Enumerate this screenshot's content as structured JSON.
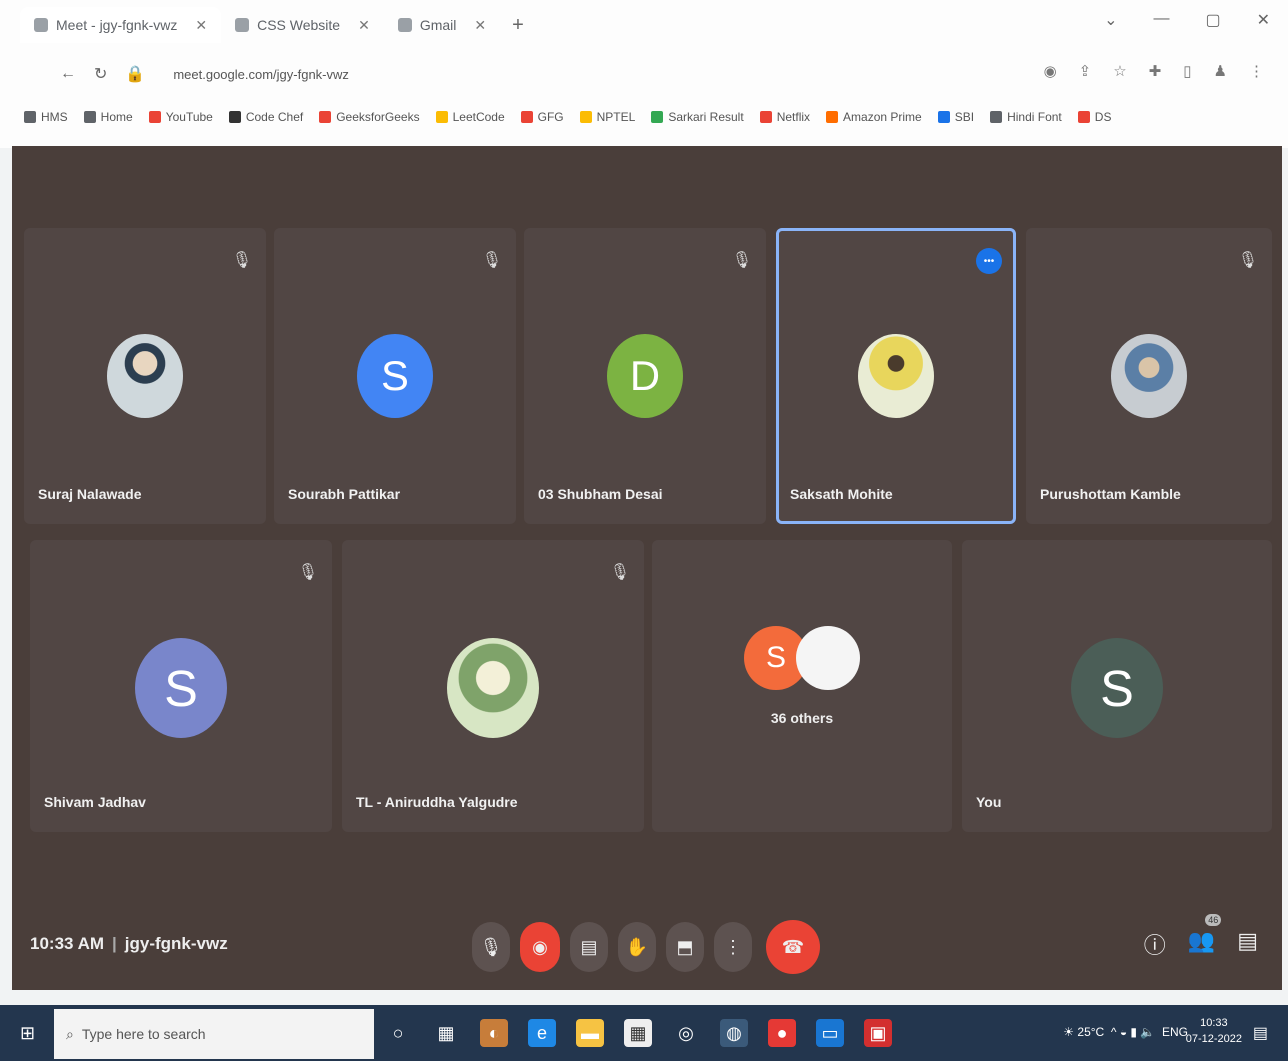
{
  "browser": {
    "tabs": [
      {
        "label": "Meet - jgy-fgnk-vwz",
        "active": true
      },
      {
        "label": "CSS Website",
        "active": false
      },
      {
        "label": "Gmail",
        "active": false
      }
    ],
    "new_tab_label": "+",
    "url": "meet.google.com/jgy-fgnk-vwz",
    "bookmarks": [
      {
        "label": "HMS",
        "color": "#5f6368"
      },
      {
        "label": "Home",
        "color": "#5f6368"
      },
      {
        "label": "YouTube",
        "color": "#ea4335"
      },
      {
        "label": "Code Chef",
        "color": "#333333"
      },
      {
        "label": "GeeksforGeeks",
        "color": "#ea4335"
      },
      {
        "label": "LeetCode",
        "color": "#fbbc04"
      },
      {
        "label": "GFG",
        "color": "#ea4335"
      },
      {
        "label": "NPTEL",
        "color": "#fbbc04"
      },
      {
        "label": "Sarkari Result",
        "color": "#34a853"
      },
      {
        "label": "Netflix",
        "color": "#ea4335"
      },
      {
        "label": "Amazon Prime",
        "color": "#ff6d00"
      },
      {
        "label": "SBI",
        "color": "#1a73e8"
      },
      {
        "label": "Hindi Font",
        "color": "#5f6368"
      },
      {
        "label": "DS",
        "color": "#ea4335"
      }
    ]
  },
  "meeting": {
    "background": "#4a3e3a",
    "participants": [
      {
        "name": "Suraj Nalawade",
        "type": "photo",
        "muted": true
      },
      {
        "name": "Sourabh Pattikar",
        "type": "letter",
        "letter": "S",
        "color": "#4285f4",
        "muted": true
      },
      {
        "name": "03 Shubham Desai",
        "type": "letter",
        "letter": "D",
        "color": "#7cb342",
        "muted": true
      },
      {
        "name": "Saksath Mohite",
        "type": "photo",
        "speaking": true,
        "muted": false
      },
      {
        "name": "Purushottam Kamble",
        "type": "photo",
        "muted": true
      },
      {
        "name": "Shivam Jadhav",
        "type": "letter",
        "letter": "S",
        "color": "#7986cb",
        "muted": true
      },
      {
        "name": "TL - Aniruddha Yalgudre",
        "type": "photo",
        "muted": true
      },
      {
        "name": "36 others",
        "type": "others",
        "letter": "S"
      },
      {
        "name": "You",
        "type": "letter",
        "letter": "S",
        "color": "#4b5e57",
        "muted": false
      }
    ],
    "time": "10:33 AM",
    "code": "jgy-fgnk-vwz",
    "controls": [
      "mic-icon",
      "camera-off-icon",
      "captions-icon",
      "raise-hand-icon",
      "present-icon",
      "more-options-icon",
      "end-call-icon"
    ],
    "people_count": "46"
  },
  "taskbar": {
    "search_placeholder": "Type here to search",
    "temperature": "25°C",
    "language": "ENG",
    "clock_time": "10:33",
    "clock_date": "07-12-2022"
  }
}
